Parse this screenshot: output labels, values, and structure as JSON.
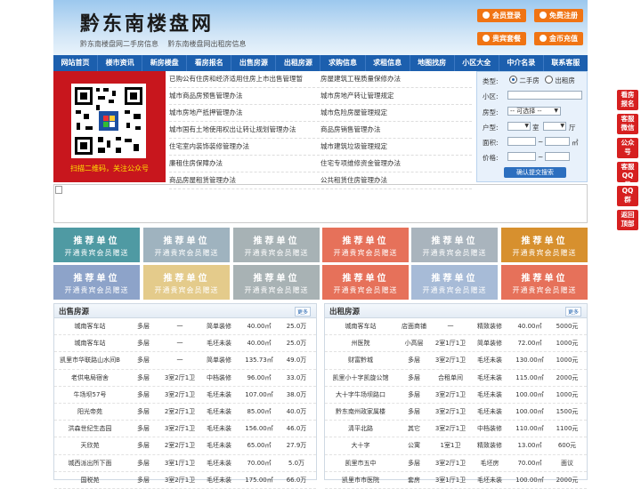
{
  "site": {
    "logo": "黔东南楼盘网",
    "sub": [
      "黔东南楼盘网二手房信息",
      "黔东南楼盘网出租房信息"
    ]
  },
  "header_buttons": [
    "会员登录",
    "免费注册",
    "贵宾套餐",
    "金币充值"
  ],
  "nav": [
    "网站首页",
    "楼市资讯",
    "新房楼盘",
    "看房报名",
    "出售房源",
    "出租房源",
    "求购信息",
    "求租信息",
    "地图找房",
    "小区大全",
    "中介名录",
    "联系客服"
  ],
  "qr_caption": "扫描二维码，关注公众号",
  "links": [
    [
      "已购公有住房和经济适用住房上市出售管理暂",
      "房屋建筑工程质量保修办法"
    ],
    [
      "城市商品房预售管理办法",
      "城市房地产转让管理规定"
    ],
    [
      "城市房地产抵押管理办法",
      "城市危险房屋管理规定"
    ],
    [
      "城市国有土地使用权出让转让规划管理办法",
      "商品房销售管理办法"
    ],
    [
      "住宅室内装饰装修管理办法",
      "城市建筑垃圾管理规定"
    ],
    [
      "廉租住房保障办法",
      "住宅专项维修资金管理办法"
    ],
    [
      "商品房屋租赁管理办法",
      "公共租赁住房管理办法"
    ]
  ],
  "search": {
    "type_label": "类型:",
    "opt_sale": "二手房",
    "opt_rent": "出租房",
    "community_label": "小区:",
    "housetype_label": "房型:",
    "housetype_value": "-- 可选择 --",
    "layout_label": "户型:",
    "room_unit": "室",
    "hall_unit": "厅",
    "area_label": "面积:",
    "area_unit": "㎡",
    "price_label": "价格:",
    "range_sep": "~",
    "submit": "确认提交搜索"
  },
  "tiles": {
    "title": "推荐单位",
    "subtitle": "开通贵宾会员赠送",
    "colors": [
      "#4f9aa3",
      "#9fb3bf",
      "#a7b2b5",
      "#e6715a",
      "#a9b4bd",
      "#d7902e",
      "#8da3c9",
      "#e4cb8b",
      "#a8b2b4",
      "#e6715a",
      "#a7bbd7",
      "#e6715a"
    ]
  },
  "sale_panel": {
    "title": "出售房源",
    "more": "更多",
    "rows": [
      [
        "城南客车站",
        "多层",
        "一",
        "简单装修",
        "40.00㎡",
        "25.0万"
      ],
      [
        "城南客车站",
        "多层",
        "一",
        "毛坯未装",
        "40.00㎡",
        "25.0万"
      ],
      [
        "凯里市华联路山水间B",
        "多层",
        "一",
        "简单装修",
        "135.73㎡",
        "49.0万"
      ],
      [
        "老供电局宿舍",
        "多层",
        "3室2厅1卫",
        "中档装修",
        "96.00㎡",
        "33.0万"
      ],
      [
        "牛场坝57号",
        "多层",
        "3室2厅1卫",
        "毛坯未装",
        "107.00㎡",
        "38.0万"
      ],
      [
        "阳光帝苑",
        "多层",
        "2室2厅1卫",
        "毛坯未装",
        "85.00㎡",
        "40.0万"
      ],
      [
        "洪森世纪生态园",
        "多层",
        "3室2厅1卫",
        "毛坯未装",
        "156.00㎡",
        "46.0万"
      ],
      [
        "天欣苑",
        "多层",
        "2室2厅1卫",
        "毛坯未装",
        "65.00㎡",
        "27.9万"
      ],
      [
        "城西派出所下面",
        "多层",
        "3室1厅1卫",
        "毛坯未装",
        "70.00㎡",
        "5.0万"
      ],
      [
        "国税苑",
        "多层",
        "3室2厅1卫",
        "毛坯未装",
        "175.00㎡",
        "66.0万"
      ]
    ]
  },
  "rent_panel": {
    "title": "出租房源",
    "more": "更多",
    "rows": [
      [
        "城南客车站",
        "店面商铺",
        "一",
        "精致装修",
        "40.00㎡",
        "5000元"
      ],
      [
        "州医院",
        "小高层",
        "2室1厅1卫",
        "简单装修",
        "72.00㎡",
        "1000元"
      ],
      [
        "财富黔城",
        "多层",
        "3室2厅1卫",
        "毛坯未装",
        "130.00㎡",
        "1000元"
      ],
      [
        "凯里小十字凯旋公馆",
        "多层",
        "合租单间",
        "毛坯未装",
        "115.00㎡",
        "2000元"
      ],
      [
        "大十字牛场坝路口",
        "多层",
        "3室2厅1卫",
        "毛坯未装",
        "100.00㎡",
        "1000元"
      ],
      [
        "黔东南州政家属楼",
        "多层",
        "3室2厅1卫",
        "毛坯未装",
        "100.00㎡",
        "1500元"
      ],
      [
        "清平北路",
        "其它",
        "3室2厅1卫",
        "中档装修",
        "110.00㎡",
        "1100元"
      ],
      [
        "大十字",
        "公寓",
        "1室1卫",
        "精致装修",
        "13.00㎡",
        "600元"
      ],
      [
        "凯里市五中",
        "多层",
        "3室2厅1卫",
        "毛坯房",
        "70.00㎡",
        "面议"
      ],
      [
        "凯里市市医院",
        "套房",
        "3室1厅1卫",
        "毛坯未装",
        "100.00㎡",
        "2000元"
      ]
    ]
  },
  "side": [
    {
      "text": "看房报名"
    },
    {
      "text": "客服微信"
    },
    {
      "text": "公众号"
    },
    {
      "text": "客服QQ号"
    },
    {
      "text": "QQ群"
    },
    {
      "text": "返回顶部"
    }
  ],
  "colors": {
    "nav": "#1c5fae",
    "accent": "#f07414",
    "qr_bg": "#c8161d",
    "side": "#d62020"
  }
}
